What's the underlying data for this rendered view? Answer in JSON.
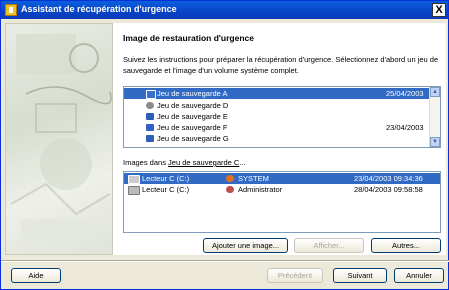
{
  "window": {
    "title": "Assistant de récupération d'urgence",
    "close_glyph": "X"
  },
  "heading": "Image de restauration d'urgence",
  "instructions": "Suivez les instructions pour préparer la récupération d'urgence. Sélectionnez d'abord un jeu de sauvegarde et l'image d'un volume système complet.",
  "sets": [
    {
      "name": "Jeu de sauvegarde A",
      "date": "25/04/2003",
      "selected": true,
      "icon": "tape-icon"
    },
    {
      "name": "Jeu de sauvegarde D",
      "date": "",
      "selected": false,
      "icon": "disc-icon"
    },
    {
      "name": "Jeu de sauvegarde E",
      "date": "",
      "selected": false,
      "icon": "network-drive-icon"
    },
    {
      "name": "Jeu de sauvegarde F",
      "date": "23/04/2003",
      "selected": false,
      "icon": "floppy-icon"
    },
    {
      "name": "Jeu de sauvegarde G",
      "date": "",
      "selected": false,
      "icon": "network-drive-icon"
    }
  ],
  "images_label_prefix": "Images dans ",
  "images_label_link": "Jeu de sauvegarde C",
  "images_label_suffix": "...",
  "images": [
    {
      "drive": "Lecteur C (C:)",
      "user": "SYSTEM",
      "datetime": "23/04/2003 09:34:36",
      "selected": true
    },
    {
      "drive": "Lecteur C (C:)",
      "user": "Administrator",
      "datetime": "28/04/2003 09:58:58",
      "selected": false
    }
  ],
  "buttons": {
    "add_image": "Ajouter une image...",
    "show": "Afficher...",
    "others": "Autres...",
    "help": "Aide",
    "previous": "Précédent",
    "next": "Suivant",
    "cancel": "Annuler"
  }
}
